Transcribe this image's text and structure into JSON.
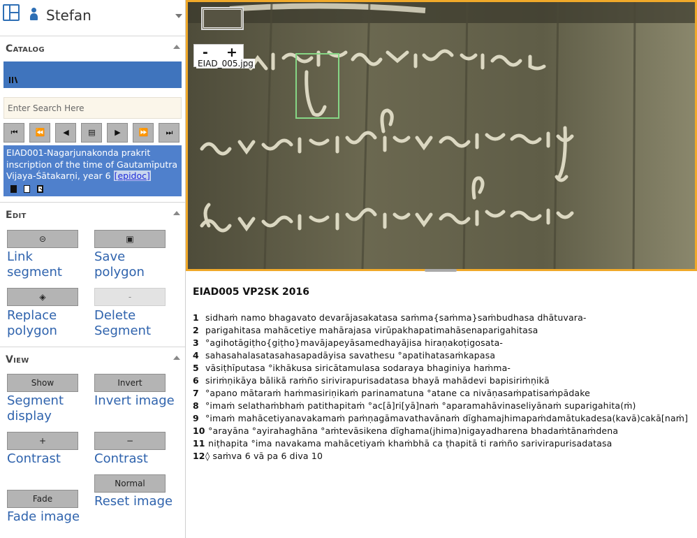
{
  "user": {
    "name": "Stefan"
  },
  "catalog": {
    "title": "Catalog",
    "search_placeholder": "Enter Search Here",
    "nav": [
      "⏮",
      "⏪",
      "◀",
      "▤",
      "▶",
      "⏩",
      "⏭"
    ],
    "selection": {
      "text": "EIAD001-Nagarjunakonda prakrit inscription of the time of Gautamīputra Vijaya-Śātakarṇi, year 6",
      "link": "[epidoc]"
    }
  },
  "edit": {
    "title": "Edit",
    "tools": [
      {
        "button": "⊝",
        "label": "Link segment"
      },
      {
        "button": "▣",
        "label": "Save polygon"
      },
      {
        "button": "◈",
        "label": "Replace polygon"
      },
      {
        "button": "-",
        "label": "Delete Segment"
      }
    ]
  },
  "view": {
    "title": "View",
    "tools": [
      {
        "button": "Show",
        "label": "Segment display"
      },
      {
        "button": "Invert",
        "label": "Invert image"
      },
      {
        "button": "+",
        "label": "Contrast"
      },
      {
        "button": "−",
        "label": "Contrast"
      },
      {
        "button": "Fade",
        "label": "Fade image"
      },
      {
        "button": "Normal",
        "label": "Reset image"
      }
    ]
  },
  "viewer": {
    "image_name": "EIAD_005.jpg",
    "zoom_out": "-",
    "zoom_in": "+"
  },
  "colors": {
    "accent": "#3f74bd",
    "viewer_border": "#f0a92a",
    "segment": "#86d685",
    "label_text": "#2f63ad"
  },
  "transcription": {
    "title": "EIAD005 VP2SK 2016",
    "lines": [
      {
        "n": "1",
        "text": "sidhaṁ namo bhagavato devarājasakatasa saṁma{saṁma}saṁbudhasa dhātuvara-"
      },
      {
        "n": "2",
        "text": "parigahitasa mahācetiye mahārajasa virūpakhapatimahāsenaparigahitasa"
      },
      {
        "n": "3",
        "text": "°agihotāgiṭho{giṭho}mavājapeyāsamedhayājisa hiraṇakoṭigosata-"
      },
      {
        "n": "4",
        "text": "sahasahalasatasahasapadāyisa savathesu °apatihatasaṁkapasa"
      },
      {
        "n": "5",
        "text": "vāsiṭhīputasa °ikhākusa siricātamulasa sodaraya bhaginiya haṁma-"
      },
      {
        "n": "6",
        "text": "siriṁṇikāya bālikā raṁño sirivirapurisadatasa bhayā mahādevi bapisiriṁṇikā"
      },
      {
        "n": "7",
        "text": "°apano mātaraṁ haṁmasiriṇikaṁ parinamatuna °atane ca nivāṇasaṁpatisaṁpādake"
      },
      {
        "n": "8",
        "text": "°imaṁ selathaṁbhaṁ patithapitaṁ °ac[ā]ri[yā]naṁ °aparamahāvinaseliyānaṁ suparigahita(ṁ)"
      },
      {
        "n": "9",
        "text": "°imaṁ mahācetiyanavakamaṁ paṁṇagāmavathavānaṁ dīghamajhimapaṁdamātukadesa(kavā)cakā[naṁ]"
      },
      {
        "n": "10",
        "text": " °arayāna °ayirahaghāna °aṁtevāsikena dīghama(jhima)nigayadharena bhadaṁtānaṁdena"
      },
      {
        "n": "11",
        "text": " niṭhapita °ima navakama mahācetiyaṁ khaṁbhā ca ṭhapitā ti raṁño sarivirapurisadatasa"
      },
      {
        "n": "12",
        "text": "◊ saṁva 6 vā pa 6 diva 10"
      }
    ]
  }
}
